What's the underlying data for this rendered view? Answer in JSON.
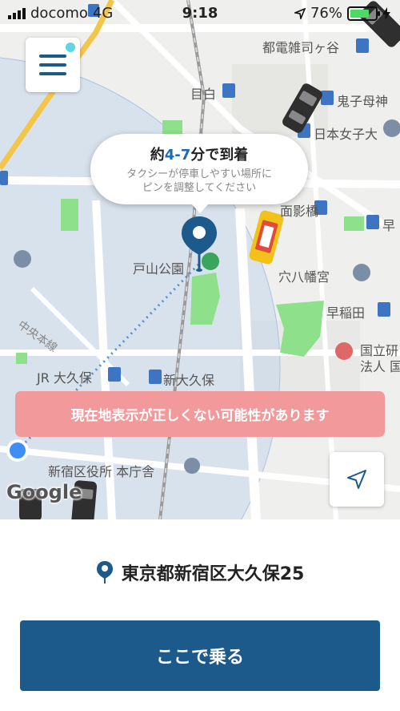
{
  "status_bar": {
    "carrier": "docomo",
    "network": "4G",
    "time": "9:18",
    "battery_percent": "76%",
    "battery_level": 0.76
  },
  "map": {
    "labels": {
      "toden_zoshigaya": "都電雑司ヶ谷",
      "mejiro": "目白",
      "kishibojin": "鬼子母神",
      "japan_womens_univ": "日本女子大",
      "toyama_park": "戸山公園",
      "anahachiman": "穴八幡宮",
      "waseda": "早稲田",
      "kokuritsu_1": "国立研",
      "kokuritsu_2": "法人 国",
      "jr_okubo": "JR 大久保",
      "shin_okubo": "新大久保",
      "shinjuku_office": "新宿区役所 本庁舎",
      "chuo_line": "中央本線",
      "partial_kage": "面影橋",
      "partial_haya": "早"
    },
    "google_logo": "Google",
    "accent_color": "#1d5a8c",
    "park_color": "#8fe08a"
  },
  "menu_button": {
    "icon": "hamburger-menu-icon",
    "has_notification": true
  },
  "eta": {
    "prefix": "約",
    "range": "4-7",
    "suffix": "分で到着",
    "hint_line1": "タクシーが停車しやすい場所に",
    "hint_line2": "ピンを調整してください"
  },
  "warning": {
    "text": "現在地表示が正しくない可能性があります"
  },
  "locate_button": {
    "icon": "navigation-arrow-icon"
  },
  "pickup": {
    "address": "東京都新宿区大久保25",
    "button_label": "ここで乗る"
  }
}
